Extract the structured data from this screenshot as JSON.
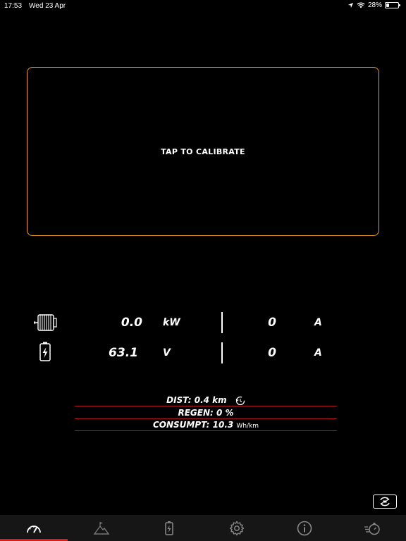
{
  "status_bar": {
    "time": "17:53",
    "date": "Wed 23 Apr",
    "battery": "28%",
    "battery_level": 0.28
  },
  "calibration": {
    "label": "TAP TO CALIBRATE"
  },
  "motor": {
    "power_value": "0.0",
    "power_unit": "kW",
    "current_value": "0",
    "current_unit": "A"
  },
  "battery": {
    "voltage_value": "63.1",
    "voltage_unit": "V",
    "current_value": "0",
    "current_unit": "A"
  },
  "trip": {
    "dist": "DIST: 0.4 km",
    "regen": "REGEN: 0 %",
    "consumpt": "CONSUMPT: 10.3",
    "consumpt_unit": "Wh/km"
  },
  "tabs": [
    "speedometer-icon",
    "elevation-icon",
    "battery-icon",
    "gear-icon",
    "info-icon",
    "stopwatch-icon"
  ],
  "colors": {
    "accent_orange": "#f0a020",
    "accent_red": "#d81d1d",
    "line_red": "#b0141c",
    "tabbar": "#161616"
  }
}
